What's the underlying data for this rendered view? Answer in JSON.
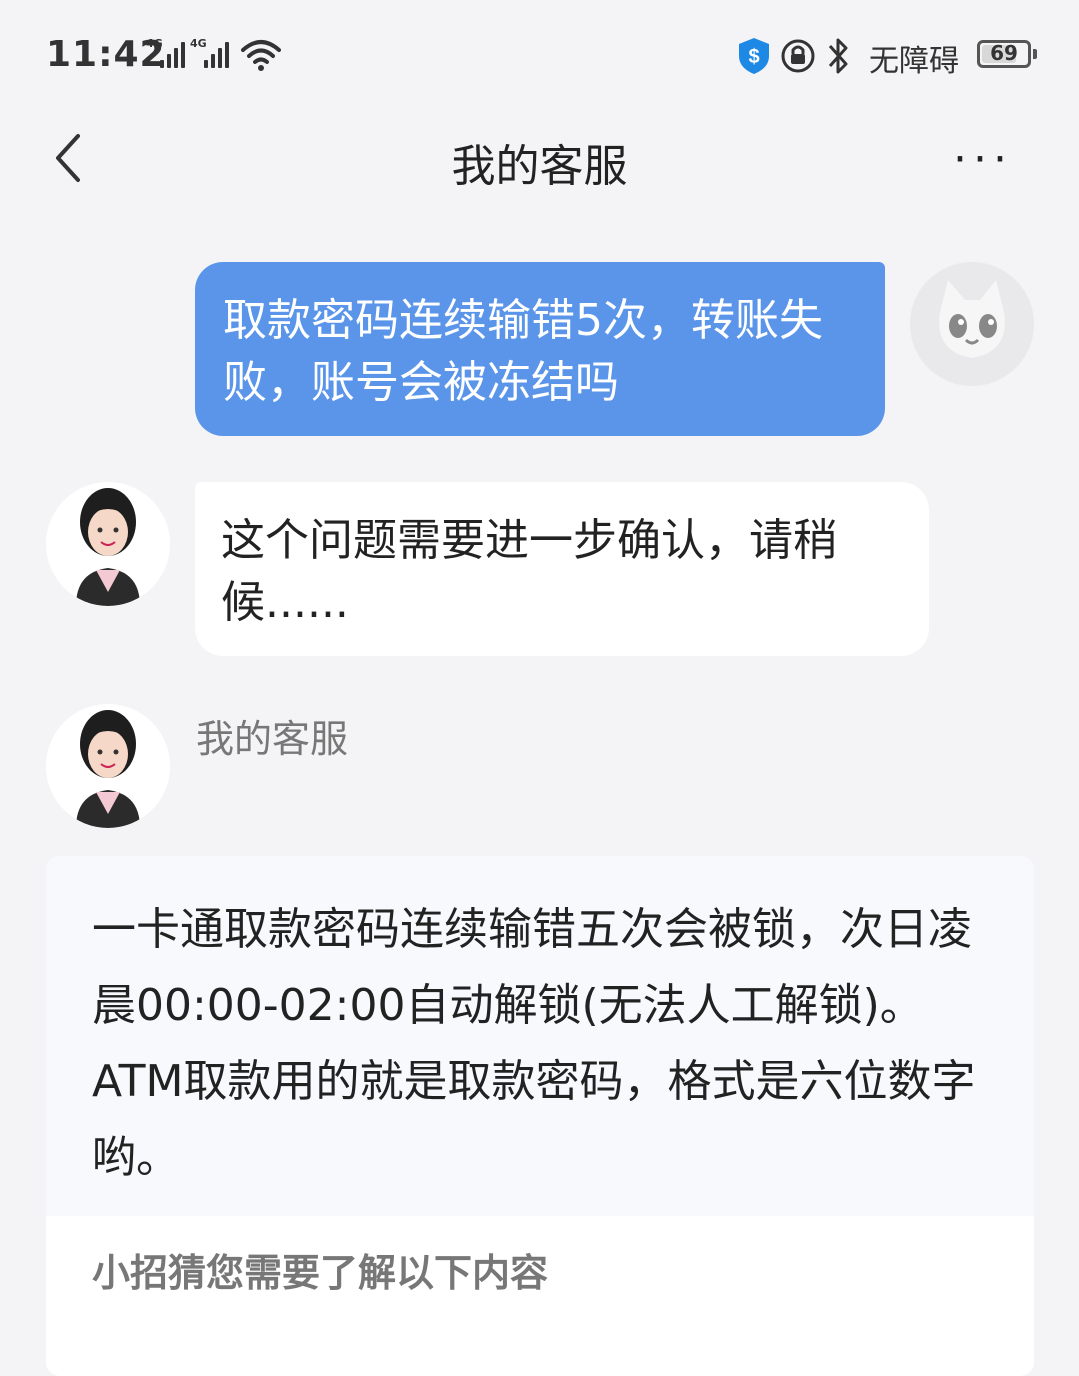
{
  "status_bar": {
    "time": "11:42",
    "signal1_label": "4G",
    "signal2_label": "4G",
    "accessibility": "无障碍",
    "battery": "69"
  },
  "nav": {
    "title": "我的客服",
    "more": "···"
  },
  "messages": {
    "user_message": "取款密码连续输错5次，转账失败，账号会被冻结吗",
    "agent_message": "这个问题需要进一步确认，请稍候......",
    "agent_name": "我的客服",
    "answer": "一卡通取款密码连续输错五次会被锁，次日凌晨00:00-02:00自动解锁(无法人工解锁)。ATM取款用的就是取款密码，格式是六位数字哟。",
    "suggest_title": "小招猜您需要了解以下内容"
  },
  "colors": {
    "user_bubble": "#5b95ea",
    "background": "#f4f4f6",
    "answer_bg": "#f7f9fc"
  }
}
